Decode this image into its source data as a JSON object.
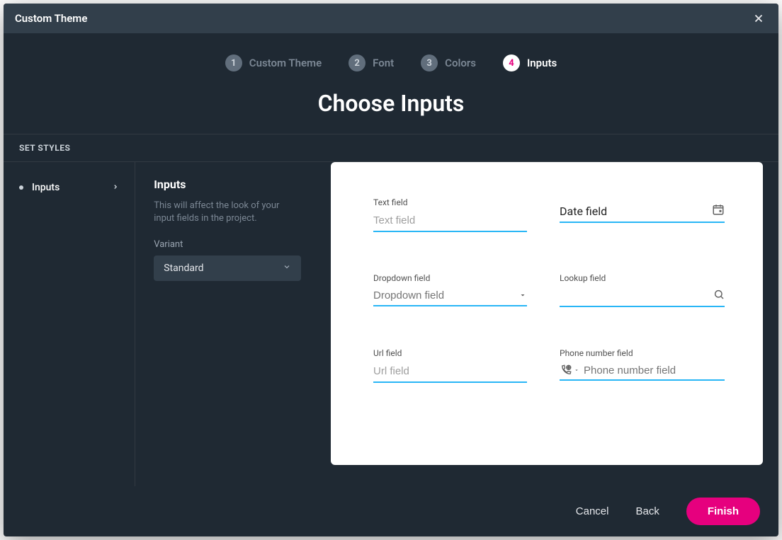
{
  "dialog": {
    "title": "Custom Theme"
  },
  "stepper": {
    "steps": [
      {
        "num": "1",
        "label": "Custom Theme"
      },
      {
        "num": "2",
        "label": "Font"
      },
      {
        "num": "3",
        "label": "Colors"
      },
      {
        "num": "4",
        "label": "Inputs"
      }
    ],
    "heading": "Choose Inputs"
  },
  "section_label": "SET STYLES",
  "sidebar": {
    "items": [
      {
        "label": "Inputs"
      }
    ]
  },
  "mid": {
    "heading": "Inputs",
    "description": "This will affect the look of your input fields in the project.",
    "variant_label": "Variant",
    "variant_value": "Standard"
  },
  "preview": {
    "text_field": {
      "label": "Text field",
      "placeholder": "Text field"
    },
    "date_field": {
      "label": "",
      "value": "Date field"
    },
    "dropdown_field": {
      "label": "Dropdown field",
      "placeholder": "Dropdown field"
    },
    "lookup_field": {
      "label": "Lookup field",
      "placeholder": ""
    },
    "url_field": {
      "label": "Url field",
      "placeholder": "Url field"
    },
    "phone_field": {
      "label": "Phone number field",
      "placeholder": "Phone number field"
    }
  },
  "footer": {
    "cancel": "Cancel",
    "back": "Back",
    "finish": "Finish"
  },
  "colors": {
    "accent": "#e6007e",
    "input_underline": "#29b6f6",
    "bg": "#1f2933"
  }
}
